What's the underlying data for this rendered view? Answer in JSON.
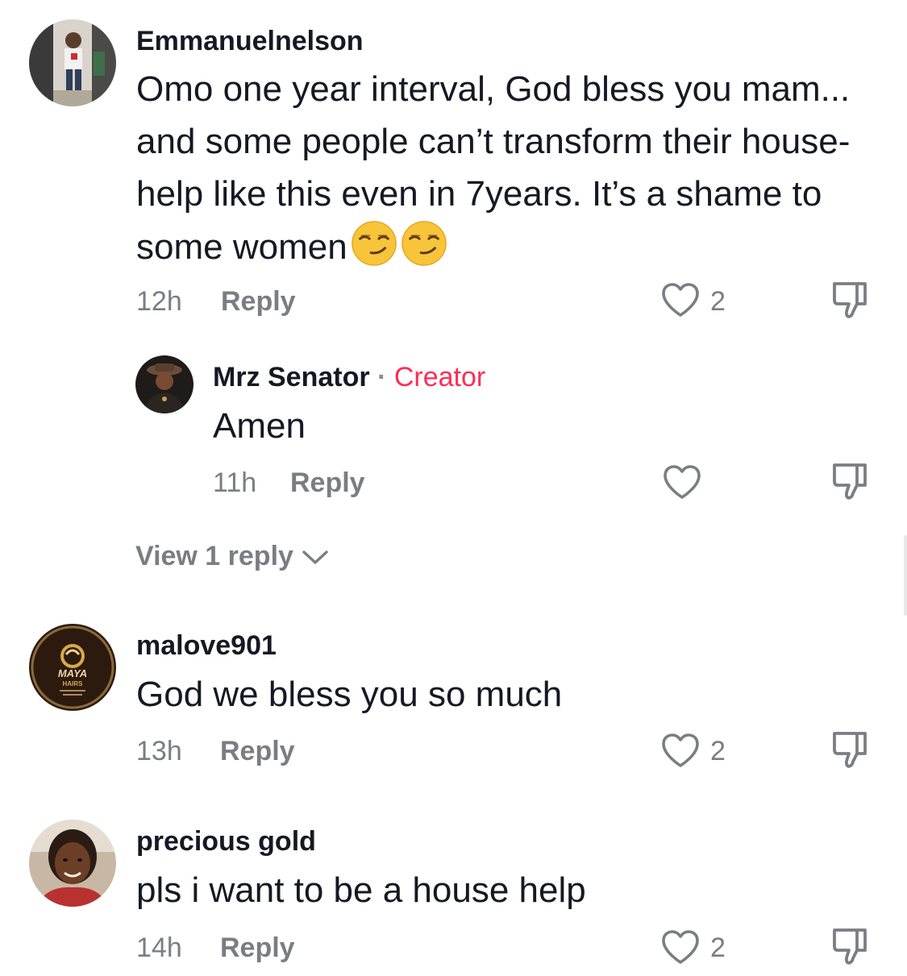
{
  "comments": [
    {
      "username": "Emmanuelnelson",
      "text": "Omo one year interval, God bless you mam... and some people can’t transform their house-help like this even in 7years. It’s a shame to some women",
      "emojis": [
        "smirk-emoji",
        "smirk-emoji"
      ],
      "time": "12h",
      "reply_label": "Reply",
      "likes": "2",
      "replies": [
        {
          "username": "Mrz Senator",
          "separator": "·",
          "badge": "Creator",
          "text": "Amen",
          "time": "11h",
          "reply_label": "Reply",
          "likes": ""
        }
      ],
      "view_replies_label": "View 1 reply"
    },
    {
      "username": "malove901",
      "text": "God we bless you so much",
      "time": "13h",
      "reply_label": "Reply",
      "likes": "2",
      "avatar_text": [
        "MAYA",
        "HAIRS"
      ]
    },
    {
      "username": "precious gold",
      "text": "pls i want to be a house help",
      "time": "14h",
      "reply_label": "Reply",
      "likes": "2"
    }
  ],
  "icons": {
    "like": "heart-outline-icon",
    "dislike": "thumbs-down-icon",
    "expand": "chevron-down-icon"
  },
  "colors": {
    "text": "#161823",
    "secondary": "#7b7d84",
    "creator_badge": "#fe2c55",
    "background": "#ffffff"
  }
}
